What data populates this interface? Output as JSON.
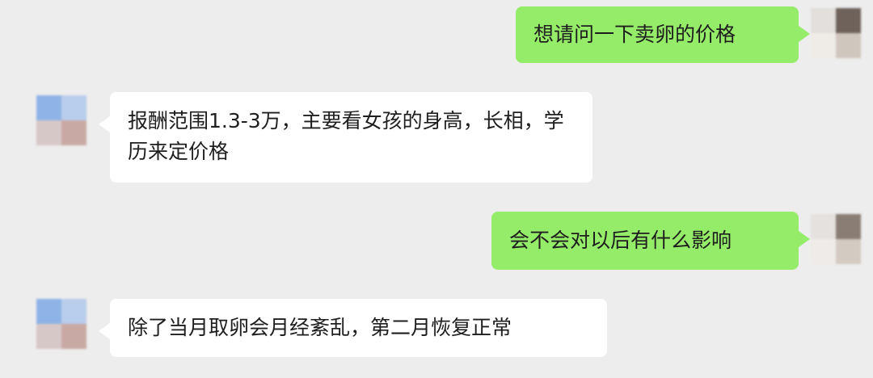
{
  "colors": {
    "background": "#ededed",
    "sent_bubble": "#95ec69",
    "received_bubble": "#ffffff",
    "text": "#1e1e1e"
  },
  "messages": [
    {
      "sender": "self",
      "text": "想请问一下卖卵的价格",
      "avatar": "blurred-avatar"
    },
    {
      "sender": "other",
      "text": "报酬范围1.3-3万，主要看女孩的身高，长相，学历来定价格",
      "avatar": "blurred-avatar"
    },
    {
      "sender": "self",
      "text": "会不会对以后有什么影响",
      "avatar": "blurred-avatar"
    },
    {
      "sender": "other",
      "text": "除了当月取卵会月经紊乱，第二月恢复正常",
      "avatar": "blurred-avatar"
    }
  ]
}
